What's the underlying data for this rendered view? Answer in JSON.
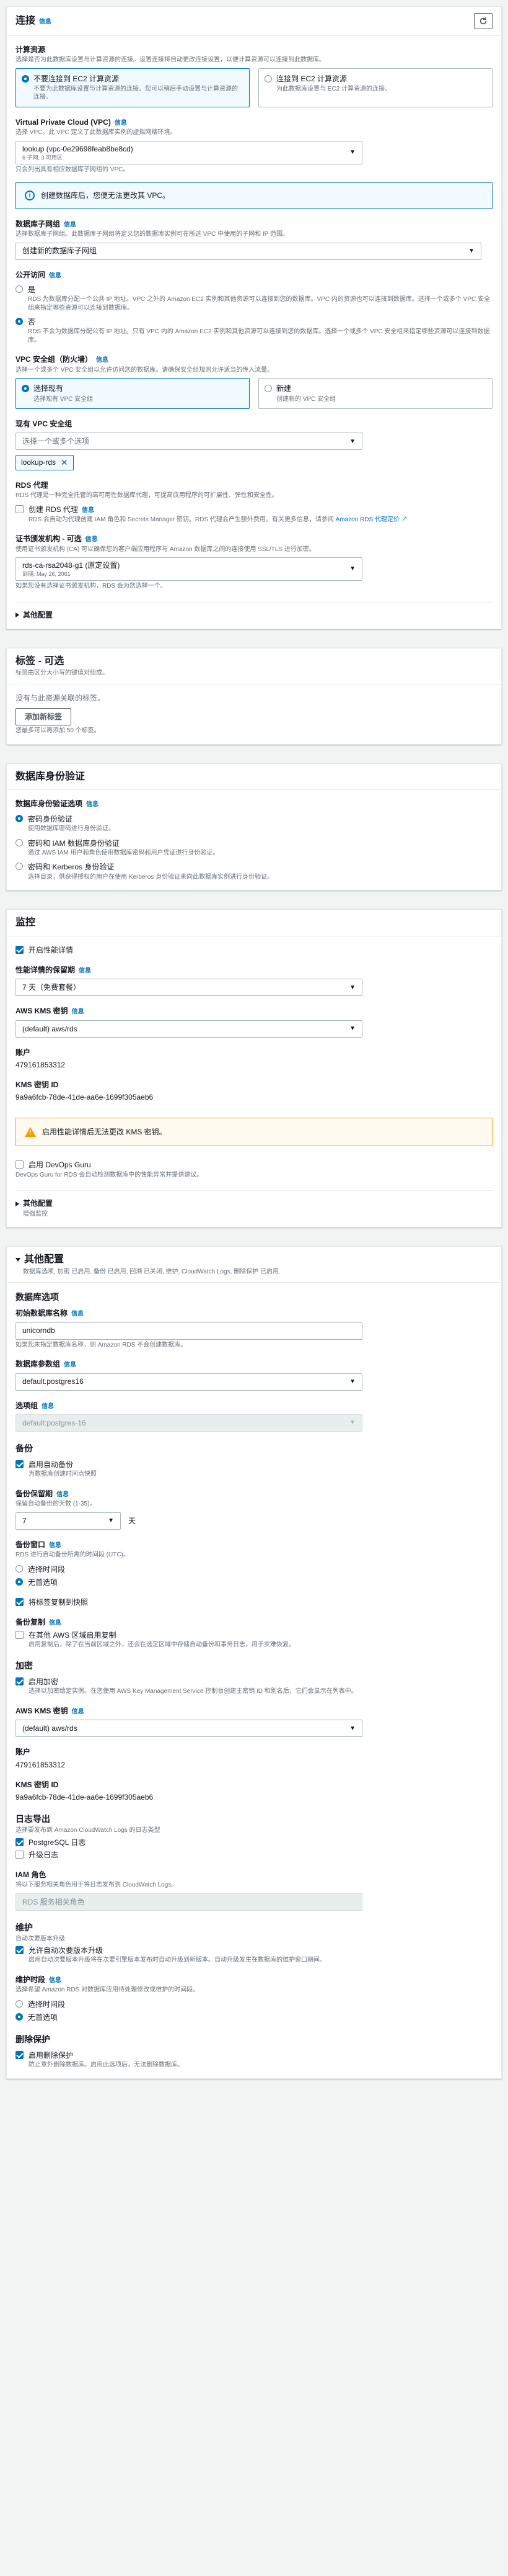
{
  "connectivity": {
    "title": "连接",
    "info": "信息",
    "compute": {
      "label": "计算资源",
      "desc": "选择是否为此数据库设置与计算资源的连接。设置连接将自动更改连接设置，以便计算资源可以连接到此数据库。",
      "options": [
        {
          "title": "不要连接到 EC2 计算资源",
          "desc": "不要为此数据库设置与计算资源的连接。您可以稍后手动设置与计算资源的连接。"
        },
        {
          "title": "连接到 EC2 计算资源",
          "desc": "为此数据库设置与 EC2 计算资源的连接。"
        }
      ]
    },
    "vpc": {
      "label": "Virtual Private Cloud (VPC)",
      "desc": "选择 VPC。此 VPC 定义了此数据库实例的虚拟网络环境。",
      "value": "lookup (vpc-0e29698feab8be8cd)",
      "sub": "6 子网, 3 可用区",
      "note": "只会列出具有相应数据库子网组的 VPC。"
    },
    "vpc_alert": "创建数据库后，您便无法更改其 VPC。",
    "subnet_group": {
      "label": "数据库子网组",
      "desc": "选择数据库子网组。此数据库子网组将定义您的数据库实例可在所选 VPC 中使用的子网和 IP 范围。",
      "value": "创建新的数据库子网组"
    },
    "public_access": {
      "label": "公开访问",
      "options": [
        {
          "title": "是",
          "desc": "RDS 为数据库分配一个公共 IP 地址。VPC 之外的 Amazon EC2 实例和其他资源可以连接到您的数据库。VPC 内的资源也可以连接到数据库。选择一个或多个 VPC 安全组来指定哪些资源可以连接到数据库。"
        },
        {
          "title": "否",
          "desc": "RDS 不会为数据库分配公有 IP 地址。只有 VPC 内的 Amazon EC2 实例和其他资源可以连接到您的数据库。选择一个或多个 VPC 安全组来指定哪些资源可以连接到数据库。"
        }
      ]
    },
    "security_group": {
      "label": "VPC 安全组（防火墙）",
      "desc": "选择一个或多个 VPC 安全组以允许访问您的数据库。请确保安全组规则允许适当的传入流量。",
      "options": [
        {
          "title": "选择现有",
          "desc": "选择现有 VPC 安全组"
        },
        {
          "title": "新建",
          "desc": "创建新的 VPC 安全组"
        }
      ]
    },
    "existing_sg": {
      "label": "现有 VPC 安全组",
      "placeholder": "选择一个或多个选项",
      "token": "lookup-rds"
    },
    "rds_proxy": {
      "label": "RDS 代理",
      "desc": "RDS 代理是一种完全托管的高可用性数据库代理，可提高应用程序的可扩展性、弹性和安全性。",
      "checkbox": "创建 RDS 代理",
      "checkbox_desc": "RDS 会自动为代理创建 IAM 角色和 Secrets Manager 密钥。RDS 代理会产生额外费用。有关更多信息，请参阅",
      "link": "Amazon RDS 代理定价"
    },
    "ca": {
      "label": "证书颁发机构 - 可选",
      "desc": "使用证书颁发机构 (CA) 可以确保您的客户端应用程序与 Amazon 数据库之间的连接使用 SSL/TLS 进行加密。",
      "value": "rds-ca-rsa2048-g1 (原定设置)",
      "sub": "到期: May 26, 2061",
      "note": "如果您没有选择证书颁发机构，RDS 会为您选择一个。"
    },
    "additional": "其他配置"
  },
  "tags": {
    "title": "标签 - 可选",
    "desc": "标签由区分大小写的键值对组成。",
    "empty": "没有与此资源关联的标签。",
    "add_button": "添加新标签",
    "note": "您最多可以再添加 50 个标签。"
  },
  "auth": {
    "title": "数据库身份验证",
    "label": "数据库身份验证选项",
    "info": "信息",
    "options": [
      {
        "title": "密码身份验证",
        "desc": "使用数据库密码进行身份验证。"
      },
      {
        "title": "密码和 IAM 数据库身份验证",
        "desc": "通过 AWS IAM 用户和角色使用数据库密码和用户凭证进行身份验证。"
      },
      {
        "title": "密码和 Kerberos 身份验证",
        "desc": "选择目录，供获得授权的用户在使用 Kerberos 身份验证来向此数据库实例进行身份验证。"
      }
    ]
  },
  "monitoring": {
    "title": "监控",
    "pi_checkbox": "开启性能详情",
    "retention": {
      "label": "性能详情的保留期",
      "value": "7 天（免费套餐）"
    },
    "kms": {
      "label": "AWS KMS 密钥",
      "value": "(default) aws/rds"
    },
    "account": {
      "label": "账户",
      "value": "479161853312"
    },
    "kms_id": {
      "label": "KMS 密钥 ID",
      "value": "9a9a6fcb-78de-41de-aa6e-1699f305aeb6"
    },
    "warn": "启用性能详情后无法更改 KMS 密钥。",
    "devops": {
      "title": "启用 DevOps Guru",
      "desc": "DevOps Guru for RDS 会自动检测数据库中的性能异常并提供建议。"
    },
    "additional": {
      "title": "其他配置",
      "desc": "增强监控"
    }
  },
  "additional_config": {
    "title": "其他配置",
    "desc": "数据库选项, 加密 已启用, 备份 已启用, 回溯 已关闭, 维护, CloudWatch Logs, 删除保护 已启用.",
    "db_options_title": "数据库选项",
    "initial_db": {
      "label": "初始数据库名称",
      "value": "unicorndb",
      "note": "如果您未指定数据库名称，则 Amazon RDS 不会创建数据库。"
    },
    "param_group": {
      "label": "数据库参数组",
      "value": "default.postgres16"
    },
    "option_group": {
      "label": "选项组",
      "value": "default:postgres-16"
    },
    "backup_title": "备份",
    "auto_backup": {
      "title": "启用自动备份",
      "desc": "为数据库创建时间点快照"
    },
    "retention": {
      "label": "备份保留期",
      "desc": "保留自动备份的天数 (1-35)。",
      "value": "7",
      "unit": "天"
    },
    "window": {
      "label": "备份窗口",
      "desc": "RDS 进行自动备份所需的时间段 (UTC)。",
      "options": [
        "选择时间段",
        "无首选项"
      ]
    },
    "copy_tags": "将标签复制到快照",
    "replication": {
      "label": "备份复制",
      "title": "在其他 AWS 区域启用复制",
      "desc": "启用复制后，除了在当前区域之外，还会在选定区域中存储自动备份和事务日志，用于灾难恢复。"
    },
    "encryption_title": "加密",
    "enable_encryption": {
      "title": "启用加密",
      "desc": "选择以加密给定实例。在您使用 AWS Key Management Service 控制台创建主密钥 ID 和别名后，它们会显示在列表中。"
    },
    "kms": {
      "label": "AWS KMS 密钥",
      "value": "(default) aws/rds"
    },
    "account": {
      "label": "账户",
      "value": "479161853312"
    },
    "kms_id": {
      "label": "KMS 密钥 ID",
      "value": "9a9a6fcb-78de-41de-aa6e-1699f305aeb6"
    },
    "logs_title": "日志导出",
    "logs_desc": "选择要发布到 Amazon CloudWatch Logs 的日志类型",
    "logs": [
      "PostgreSQL 日志",
      "升级日志"
    ],
    "iam_role": {
      "label": "IAM 角色",
      "desc": "将以下服务相关角色用于将日志发布到 CloudWatch Logs。",
      "value": "RDS 服务相关角色"
    },
    "maintenance_title": "维护",
    "auto_upgrade_label": "自动次要版本升级",
    "auto_upgrade": {
      "title": "允许自动次要版本升级",
      "desc": "启用自动次要版本升级将在次要引擎版本发布时自动升级到新版本。自动升级发生在数据库的维护窗口期间。"
    },
    "maint_window": {
      "label": "维护时段",
      "desc": "选择希望 Amazon RDS 对数据库应用待处理修改或维护的时间段。",
      "options": [
        "选择时间段",
        "无首选项"
      ]
    },
    "deletion_title": "删除保护",
    "deletion": {
      "title": "启用删除保护",
      "desc": "防止意外删除数据库。启用此选项后，无法删除数据库。"
    }
  }
}
